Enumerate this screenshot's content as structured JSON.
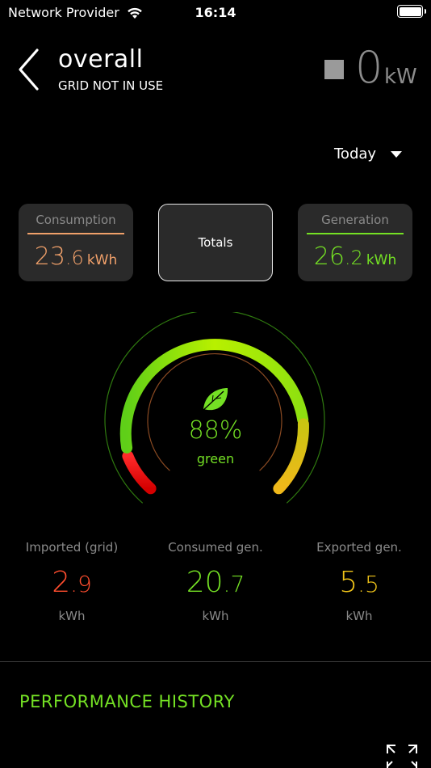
{
  "status_bar": {
    "carrier": "Network Provider",
    "time": "16:14",
    "wifi_icon": "wifi-icon",
    "battery_icon": "battery-icon"
  },
  "header": {
    "back_icon": "chevron-left-icon",
    "title": "overall",
    "subtitle": "GRID NOT IN USE",
    "power_value": "0",
    "power_unit": "kW"
  },
  "period": {
    "selected": "Today",
    "icon": "caret-down-icon"
  },
  "cards": {
    "consumption": {
      "title": "Consumption",
      "int": "23",
      "dec": ".6",
      "unit": "kWh",
      "color": "#f0a06a"
    },
    "totals": {
      "label": "Totals"
    },
    "generation": {
      "title": "Generation",
      "int": "26",
      "dec": ".2",
      "unit": "kWh",
      "color": "#74e024"
    }
  },
  "gauge": {
    "percent": "88%",
    "caption": "green",
    "value": 0.88,
    "icon": "leaf-icon"
  },
  "stats": [
    {
      "title": "Imported (grid)",
      "int": "2",
      "dec": ".9",
      "unit": "kWh",
      "color": "#ff4d2e"
    },
    {
      "title": "Consumed gen.",
      "int": "20",
      "dec": ".7",
      "unit": "kWh",
      "color": "#74e024"
    },
    {
      "title": "Exported gen.",
      "int": "5",
      "dec": ".5",
      "unit": "kWh",
      "color": "#f0c419"
    }
  ],
  "performance": {
    "title": "PERFORMANCE HISTORY",
    "expand_icon": "expand-icon"
  },
  "colors": {
    "accent": "#74e024",
    "consumption": "#f0a06a",
    "import": "#ff4d2e",
    "export": "#f0c419",
    "muted": "#8a8a8a"
  }
}
